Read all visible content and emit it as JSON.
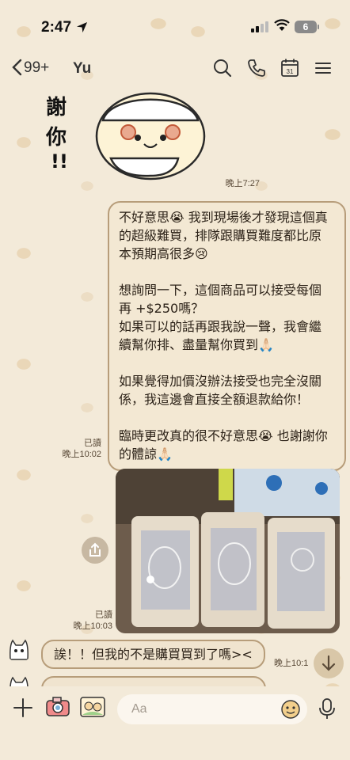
{
  "status_bar": {
    "time": "2:47",
    "battery_level": "6"
  },
  "header": {
    "back_count": "99+",
    "chat_name": "Yu"
  },
  "messages": {
    "sticker_time": "晚上7:27",
    "msg1": {
      "text": "不好意思😭 我到現場後才發現這個真的超級難買，排隊跟購買難度都比原本預期高很多😢\n\n想詢問一下，這個商品可以接受每個再 +$250嗎？\n如果可以的話再跟我說一聲，我會繼續幫你排、盡量幫你買到🙏🏻\n\n如果覺得加價沒辦法接受也完全沒關係，我這邊會直接全額退款給你！\n\n臨時更改真的很不好意思😭 也謝謝你的體諒🙏🏻",
      "read": "已讀",
      "time": "晚上10:02"
    },
    "photo_read": "已讀",
    "photo_time": "晚上10:03",
    "reply": {
      "text": "誒！！但我的不是購買買到了嗎><",
      "time": "晚上10:1"
    }
  },
  "input": {
    "placeholder": "Aa"
  },
  "icons": [
    "location-arrow-icon",
    "signal-icon",
    "wifi-icon",
    "battery-icon",
    "chevron-left-icon",
    "search-icon",
    "phone-icon",
    "calendar-icon",
    "menu-icon",
    "share-icon",
    "arrow-down-icon",
    "plus-icon",
    "camera-icon",
    "photo-icon",
    "emoji-icon",
    "microphone-icon"
  ],
  "colors": {
    "bubble_bg": "#f3e8d3",
    "bubble_border": "#b79d7a",
    "chat_bg": "#f3ead9"
  }
}
